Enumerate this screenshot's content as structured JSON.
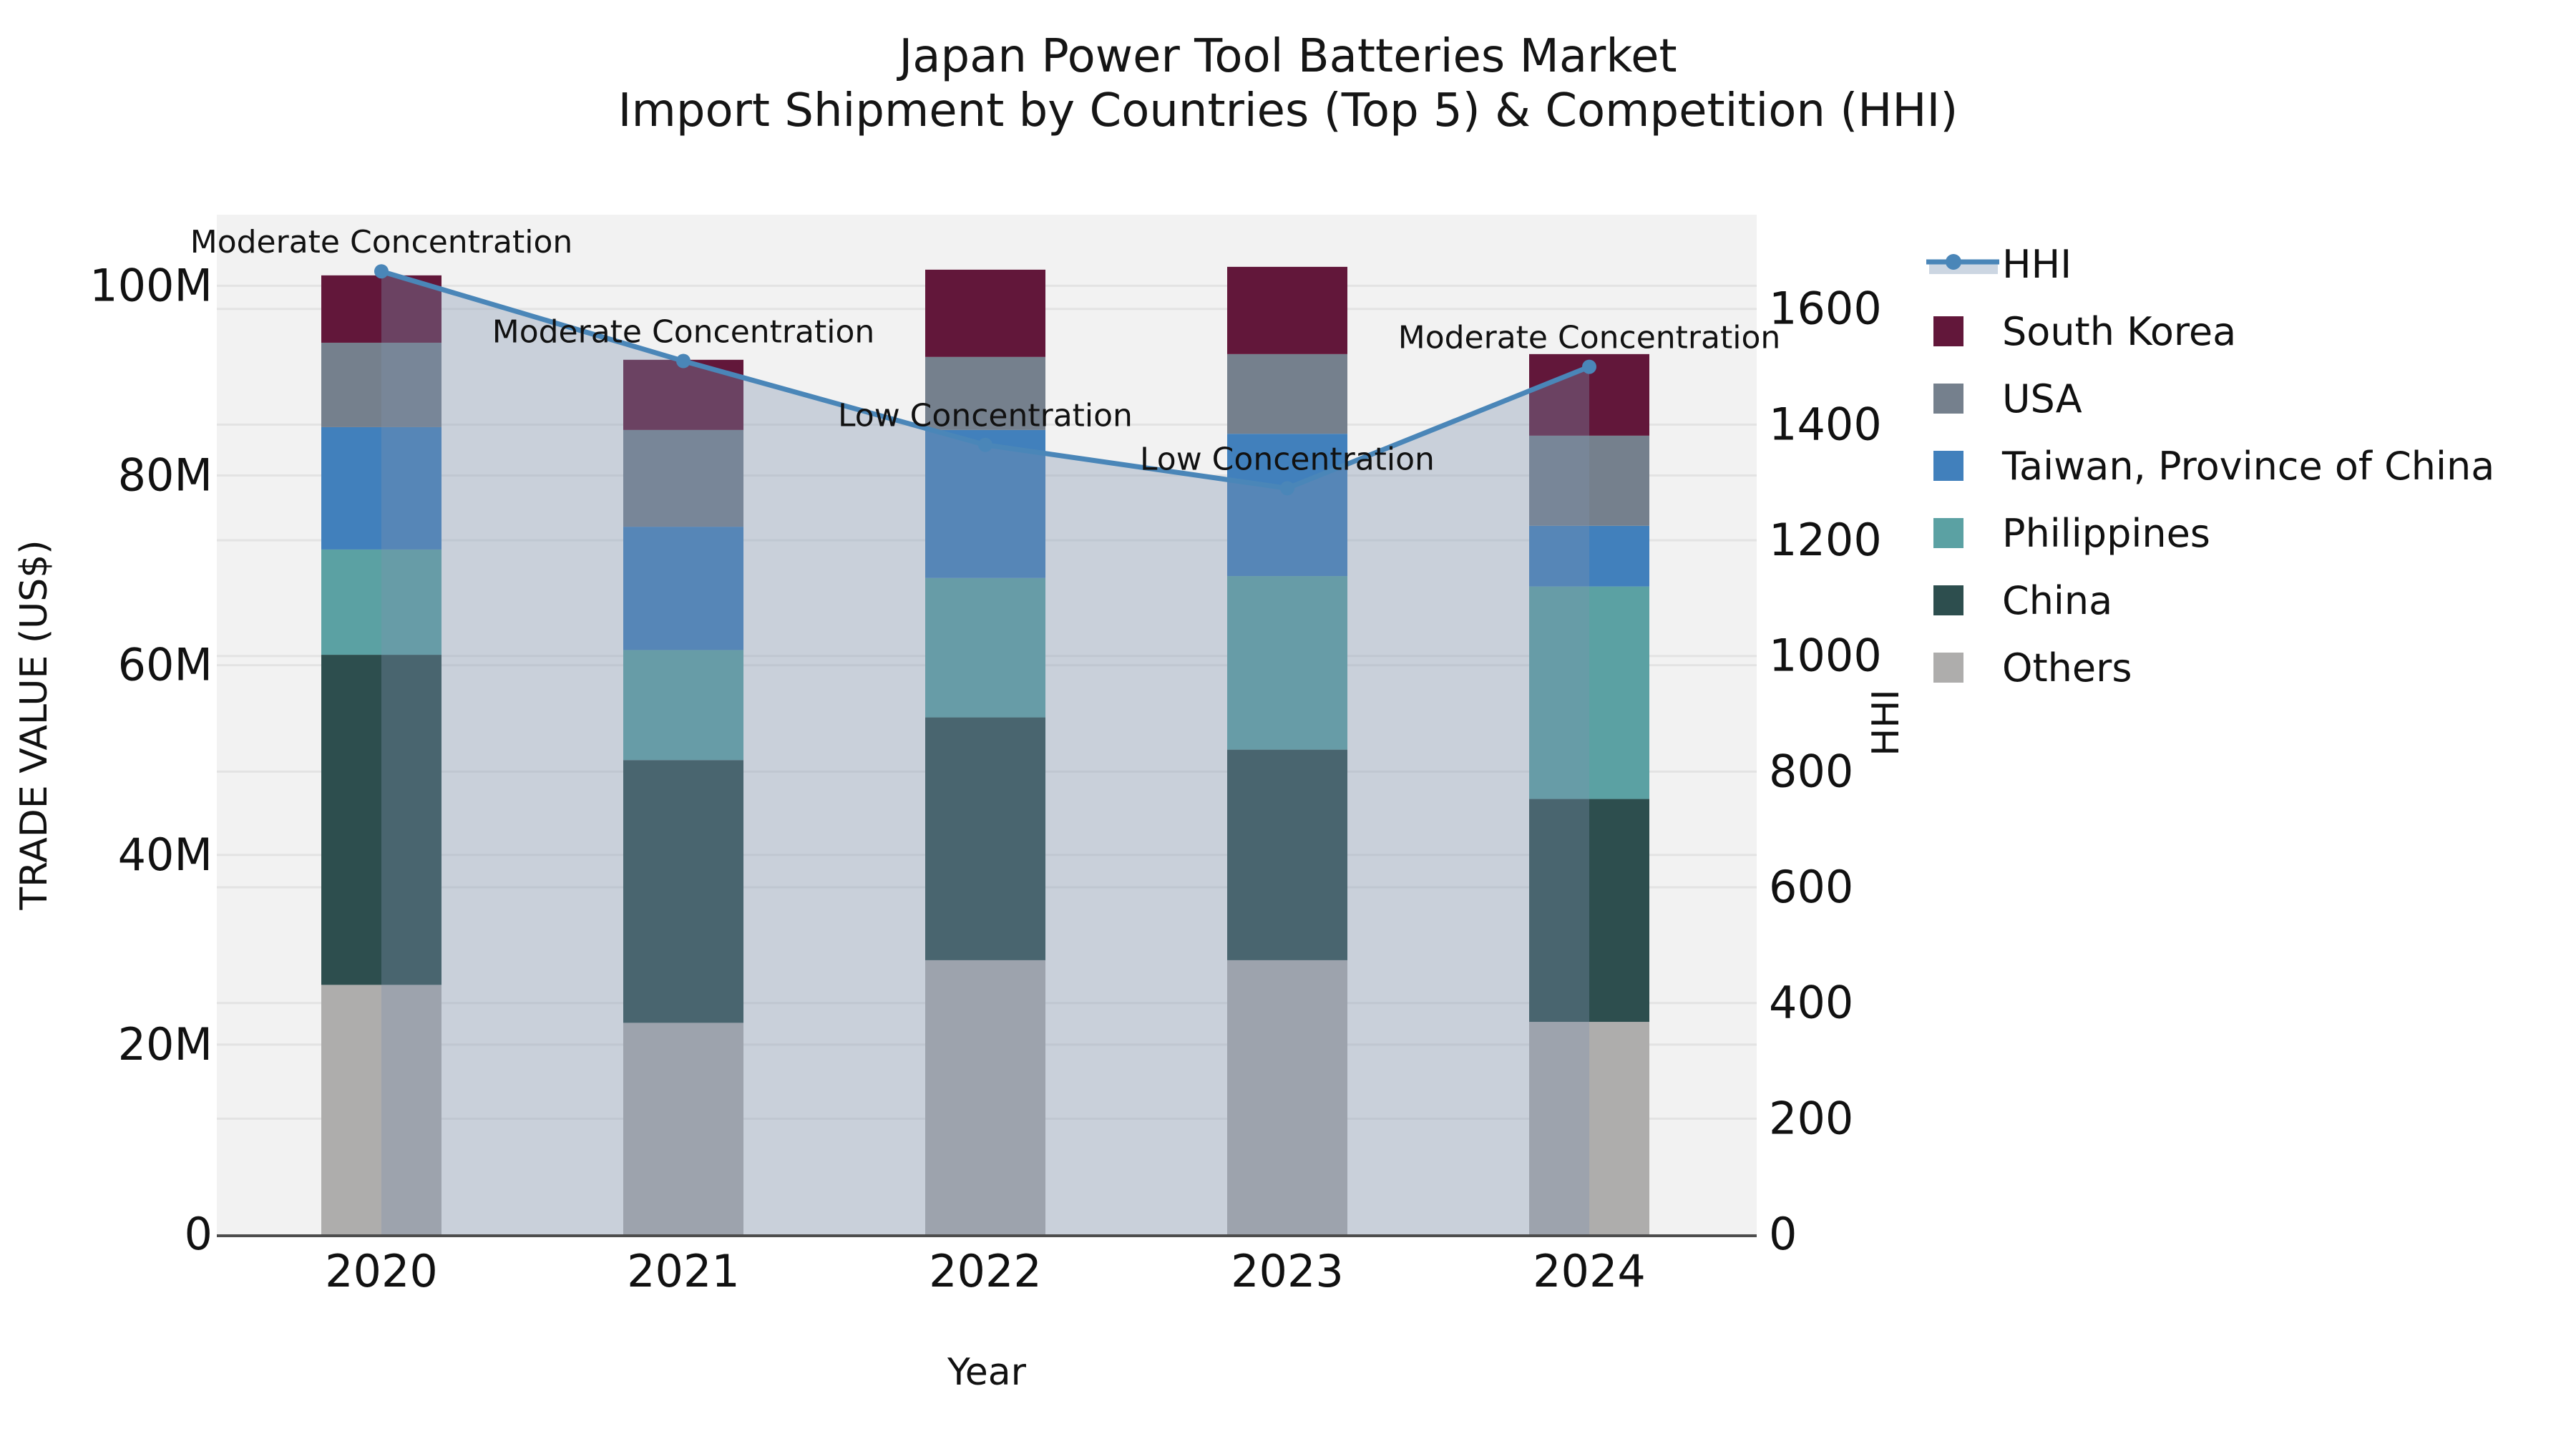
{
  "figure": {
    "title": "Japan Power Tool Batteries Market",
    "subtitle": "Import Shipment by Countries (Top 5) & Competition (HHI)",
    "background": "#ffffff",
    "plot_background": "#f2f2f2",
    "gridline_color": "#e3e3e3"
  },
  "chart_data": {
    "type": "bar",
    "subtype": "stacked-bars-with-line-area",
    "title": "Japan Power Tool Batteries Market",
    "subtitle": "Import Shipment by Countries (Top 5) & Competition (HHI)",
    "xlabel": "Year",
    "ylabel_left": "TRADE VALUE (US$)",
    "ylabel_right": "HHI",
    "categories": [
      "2020",
      "2021",
      "2022",
      "2023",
      "2024"
    ],
    "value_unit": "M",
    "series": [
      {
        "name": "Others",
        "color": "#aeadac",
        "values": [
          26.3,
          22.3,
          28.9,
          28.9,
          22.4
        ]
      },
      {
        "name": "China",
        "color": "#2d4e4e",
        "values": [
          34.8,
          27.7,
          25.6,
          22.2,
          23.5
        ]
      },
      {
        "name": "Philippines",
        "color": "#5ba1a3",
        "values": [
          11.1,
          11.6,
          14.7,
          18.3,
          22.4
        ]
      },
      {
        "name": "Taiwan, Province of China",
        "color": "#4180bc",
        "values": [
          12.9,
          13.0,
          15.6,
          15.0,
          6.4
        ]
      },
      {
        "name": "USA",
        "color": "#75808d",
        "values": [
          8.9,
          10.2,
          7.7,
          8.4,
          9.5
        ]
      },
      {
        "name": "South Korea",
        "color": "#62173a",
        "values": [
          7.1,
          7.4,
          9.2,
          9.2,
          8.6
        ]
      }
    ],
    "line_series": {
      "name": "HHI",
      "color": "#4a86b8",
      "area_fill": "rgba(125,145,175,0.35)",
      "legend_band_color": "#ccd6e2",
      "values": [
        1665,
        1510,
        1365,
        1290,
        1500
      ]
    },
    "annotations": [
      "Moderate Concentration",
      "Moderate Concentration",
      "Low Concentration",
      "Low Concentration",
      "Moderate Concentration"
    ],
    "y_left_axis": {
      "tick_labels": [
        "0",
        "20M",
        "40M",
        "60M",
        "80M",
        "100M"
      ],
      "tick_values": [
        0,
        20,
        40,
        60,
        80,
        100
      ],
      "ylim": [
        0,
        107.5
      ]
    },
    "y_right_axis": {
      "tick_labels": [
        "0",
        "200",
        "400",
        "600",
        "800",
        "1000",
        "1200",
        "1400",
        "1600"
      ],
      "tick_values": [
        0,
        200,
        400,
        600,
        800,
        1000,
        1200,
        1400,
        1600
      ],
      "ylim": [
        0,
        1763
      ]
    },
    "legend": {
      "position": "right",
      "items": [
        "HHI",
        "South Korea",
        "USA",
        "Taiwan, Province of China",
        "Philippines",
        "China",
        "Others"
      ]
    },
    "grid": "horizontal, both axes' major ticks"
  }
}
